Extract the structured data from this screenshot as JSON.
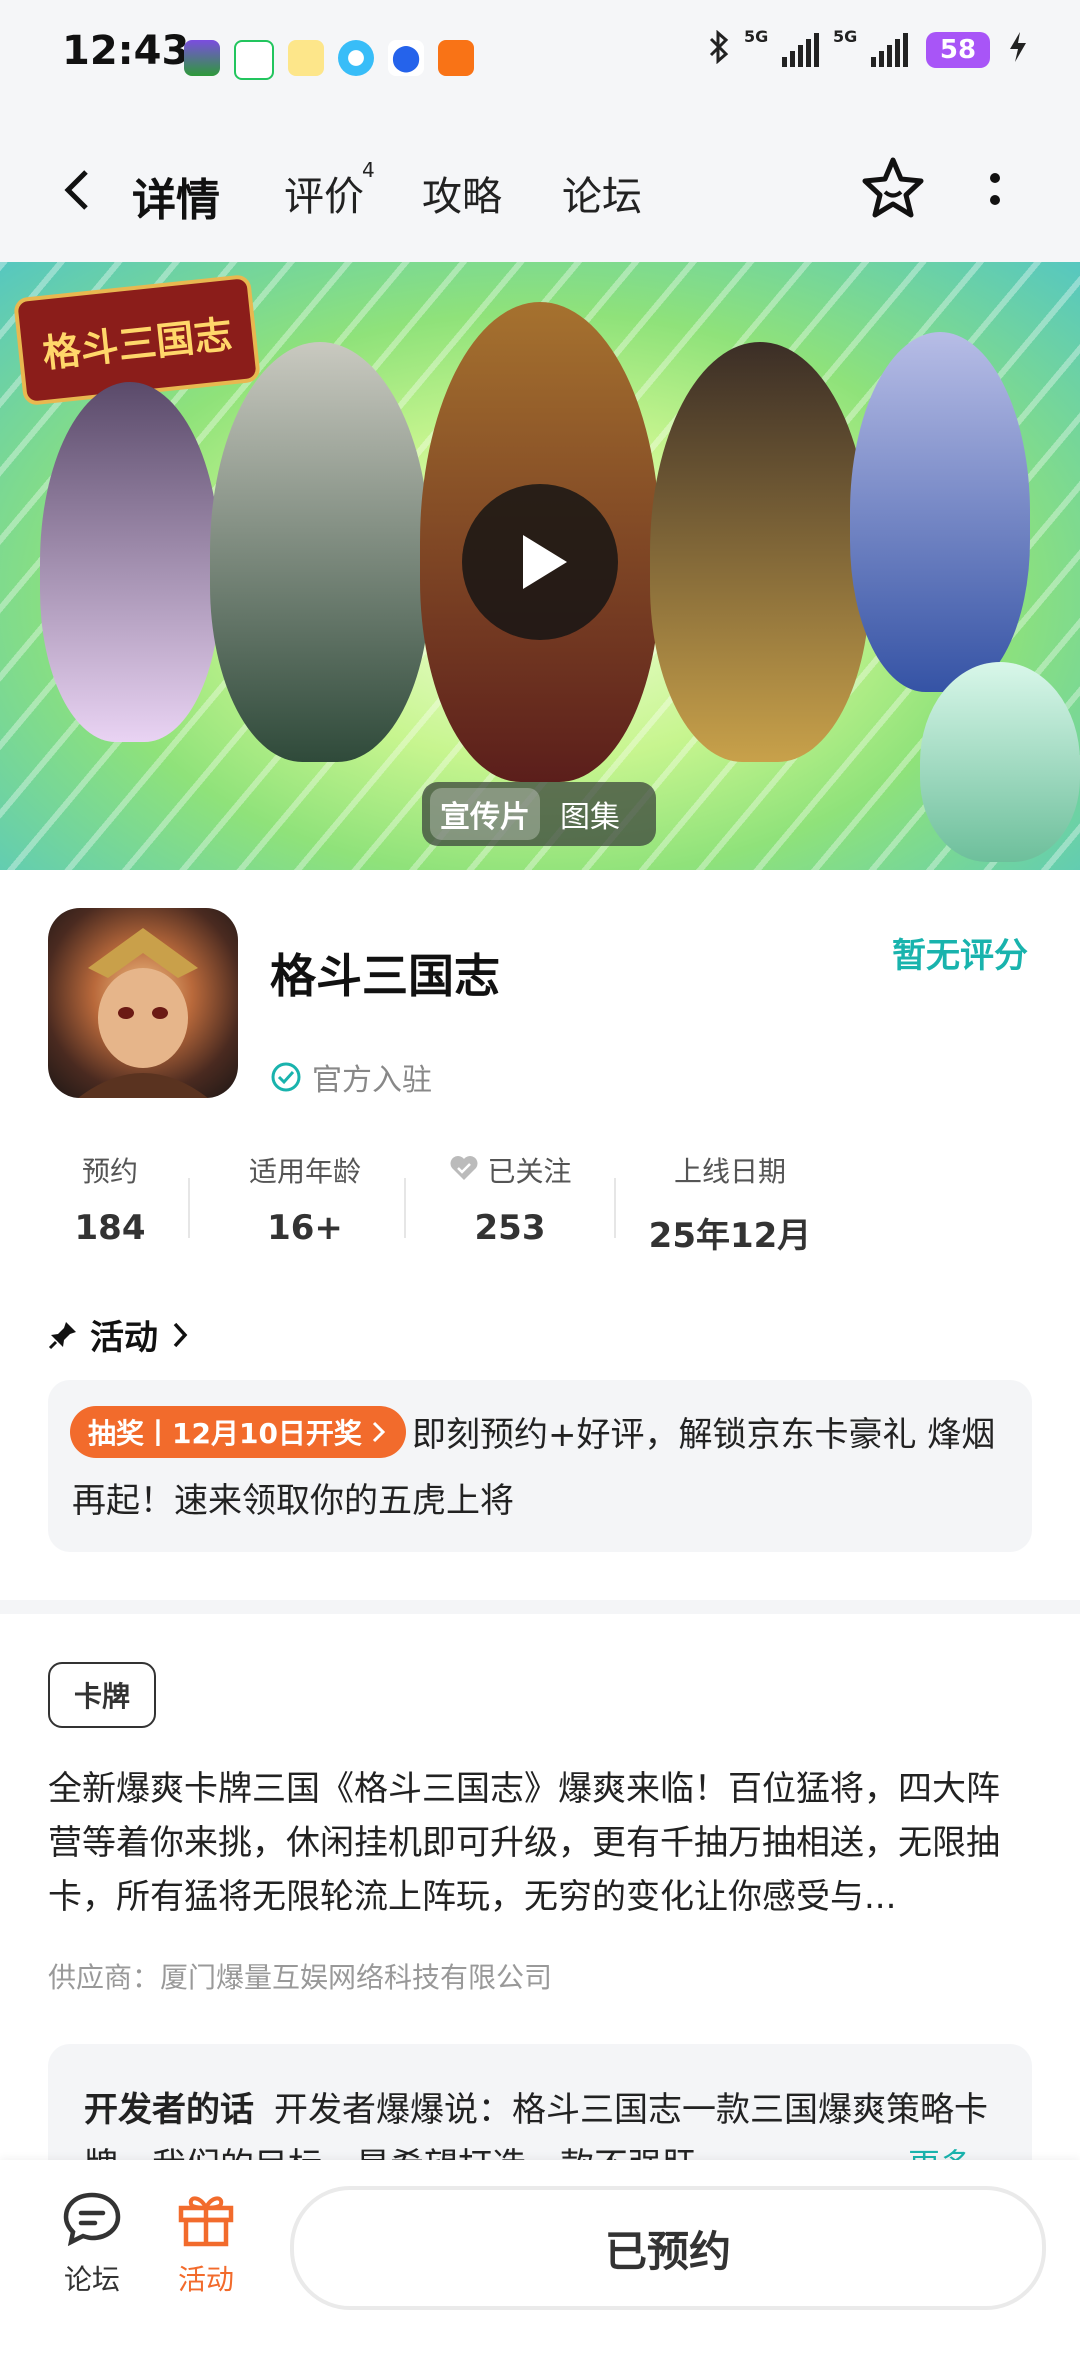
{
  "status_bar": {
    "time": "12:43",
    "network_1": "5G",
    "network_2": "5G",
    "battery": "58"
  },
  "nav": {
    "tabs": [
      "详情",
      "评价",
      "攻略",
      "论坛"
    ],
    "review_count": "4",
    "active_tab": "详情"
  },
  "banner": {
    "logo_text": "格斗三国志",
    "media_tabs": [
      "宣传片",
      "图集"
    ],
    "selected_media": "宣传片"
  },
  "game": {
    "title": "格斗三国志",
    "official_label": "官方入驻",
    "rating_text": "暂无评分"
  },
  "stats": [
    {
      "label": "预约",
      "value": "184"
    },
    {
      "label": "适用年龄",
      "value": "16+"
    },
    {
      "label": "已关注",
      "value": "253"
    },
    {
      "label": "上线日期",
      "value": "25年12月"
    }
  ],
  "activity": {
    "heading": "活动",
    "tag": "抽奖丨12月10日开奖",
    "text": "即刻预约+好评，解锁京东卡豪礼 烽烟再起！速来领取你的五虎上将"
  },
  "details": {
    "genre": "卡牌",
    "description": "全新爆爽卡牌三国《格斗三国志》爆爽来临！百位猛将，四大阵营等着你来挑，休闲挂机即可升级，更有千抽万抽相送，无限抽卡，所有猛将无限轮流上阵玩，无穷的变化让你感受与...",
    "supplier": "供应商：厦门爆量互娱网络科技有限公司"
  },
  "developer": {
    "label": "开发者的话",
    "text": "开发者爆爆说：格斗三国志一款三国爆爽策略卡牌，我们的目标，是希望打造一款不强肝",
    "more": "更多"
  },
  "bottom_bar": {
    "forum_label": "论坛",
    "activity_label": "活动",
    "reserve_label": "已预约"
  },
  "colors": {
    "accent": "#19b3ad",
    "tab_underline": "#19c2b8",
    "lottery": "#f26b2c",
    "activity_icon": "#f26b2c",
    "battery": "#a855f7"
  }
}
